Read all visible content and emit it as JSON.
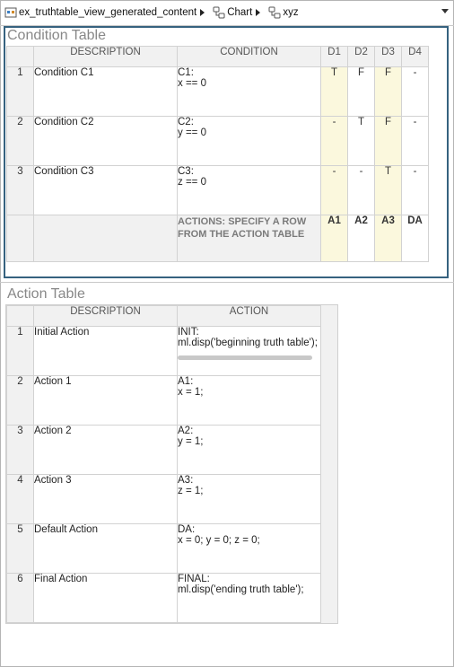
{
  "breadcrumb": {
    "items": [
      {
        "label": "ex_truthtable_view_generated_content",
        "icon": "model-icon"
      },
      {
        "label": "Chart",
        "icon": "chart-icon"
      },
      {
        "label": "xyz",
        "icon": "truth-table-icon"
      }
    ]
  },
  "condition_table": {
    "title": "Condition Table",
    "headers": {
      "description": "DESCRIPTION",
      "condition": "CONDITION",
      "decisions": [
        "D1",
        "D2",
        "D3",
        "D4"
      ]
    },
    "rows": [
      {
        "num": "1",
        "description": "Condition C1",
        "condition": "C1:\nx == 0",
        "values": [
          "T",
          "F",
          "F",
          "-"
        ]
      },
      {
        "num": "2",
        "description": "Condition C2",
        "condition": "C2:\ny == 0",
        "values": [
          "-",
          "T",
          "F",
          "-"
        ]
      },
      {
        "num": "3",
        "description": "Condition C3",
        "condition": "C3:\nz == 0",
        "values": [
          "-",
          "-",
          "T",
          "-"
        ]
      }
    ],
    "actions_row": {
      "label": "ACTIONS: SPECIFY A ROW\nFROM THE ACTION TABLE",
      "values": [
        "A1",
        "A2",
        "A3",
        "DA"
      ]
    },
    "highlight_columns": [
      0,
      2
    ],
    "highlight_color": "#fbf8dd"
  },
  "action_table": {
    "title": "Action Table",
    "headers": {
      "description": "DESCRIPTION",
      "action": "ACTION"
    },
    "rows": [
      {
        "num": "1",
        "description": "Initial Action",
        "action": "INIT:\nml.disp('beginning truth table');"
      },
      {
        "num": "2",
        "description": "Action 1",
        "action": "A1:\nx = 1;"
      },
      {
        "num": "3",
        "description": "Action 2",
        "action": "A2:\ny = 1;"
      },
      {
        "num": "4",
        "description": "Action 3",
        "action": "A3:\nz = 1;"
      },
      {
        "num": "5",
        "description": "Default Action",
        "action": "DA:\nx = 0; y = 0; z = 0;"
      },
      {
        "num": "6",
        "description": "Final Action",
        "action": "FINAL:\nml.disp('ending truth table');"
      }
    ]
  },
  "colors": {
    "panel_border": "#36627f",
    "header_bg": "#f1f1f1",
    "title_gray": "#888888"
  }
}
